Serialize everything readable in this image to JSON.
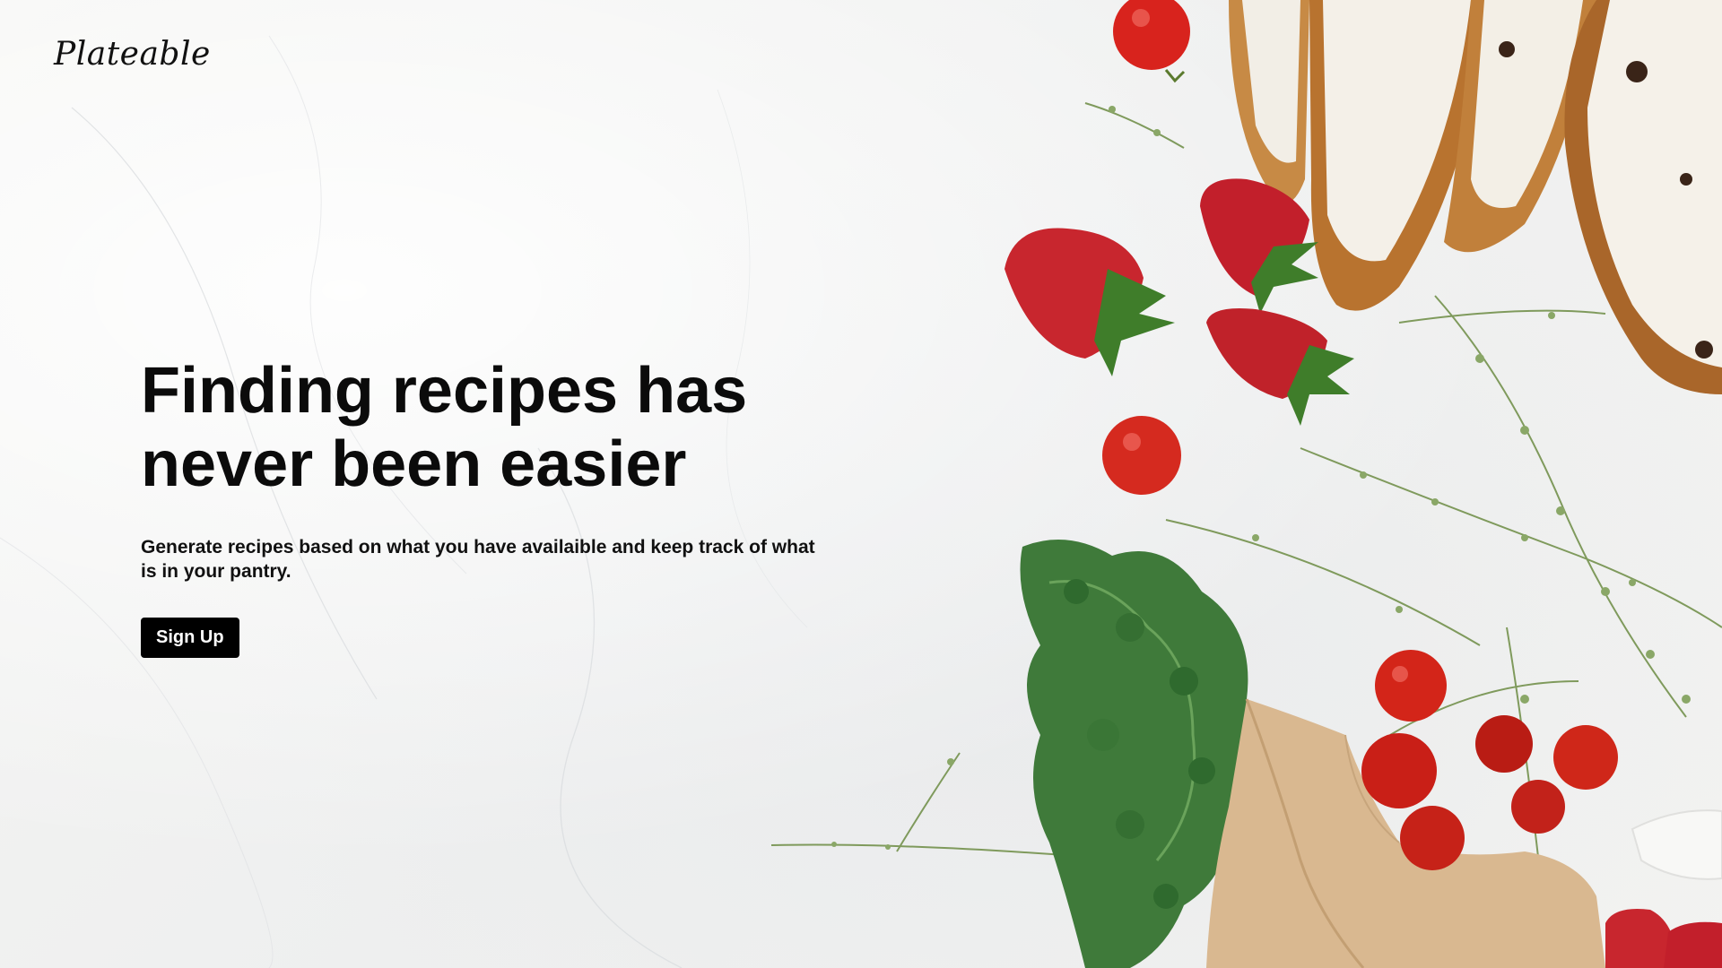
{
  "brand": {
    "logo_text": "Plateable"
  },
  "hero": {
    "headline_line1": "Finding recipes has",
    "headline_line2": "never been easier",
    "subtext": "Generate recipes based on what you have availaible and keep track of what is in your pantry.",
    "cta_label": "Sign Up"
  },
  "colors": {
    "background": "#f1f1ef",
    "text": "#0b0b0b",
    "button_bg": "#000000",
    "button_text": "#ffffff"
  }
}
